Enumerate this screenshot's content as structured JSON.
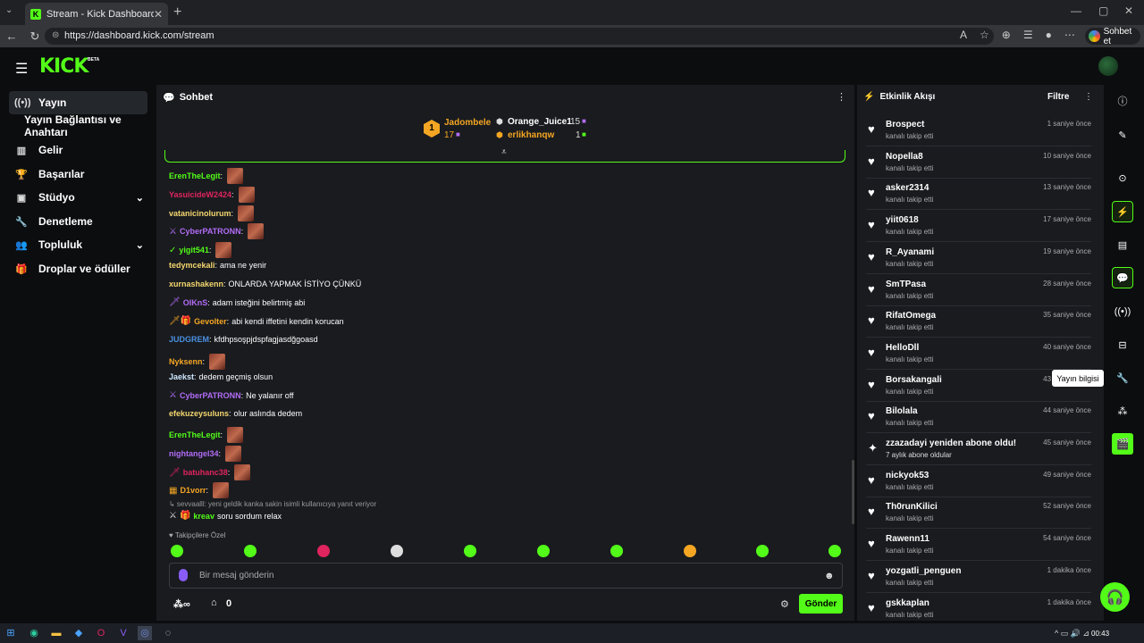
{
  "browser": {
    "tab_title": "Stream - Kick Dashboard",
    "tab_close": "✕",
    "new_tab": "+",
    "url": "https://dashboard.kick.com/stream",
    "sohbet_label": "Sohbet et"
  },
  "app": {
    "logo": "KICK",
    "beta": "BETA"
  },
  "sidebar": {
    "items": [
      {
        "label": "Yayın"
      },
      {
        "label": "Yayın Bağlantısı ve Anahtarı"
      },
      {
        "label": "Gelir"
      },
      {
        "label": "Başarılar"
      },
      {
        "label": "Stüdyo"
      },
      {
        "label": "Denetleme"
      },
      {
        "label": "Topluluk"
      },
      {
        "label": "Droplar ve ödüller"
      }
    ]
  },
  "chat": {
    "title": "Sohbet",
    "top_gifters": [
      {
        "rank": "1",
        "name": "Jadombele",
        "count": "17"
      },
      {
        "name": "Orange_Juice1",
        "count": "15"
      },
      {
        "name": "erlikhanqw",
        "count": "1"
      }
    ],
    "messages": [
      {
        "user": "ErenTheLegit",
        "color": "#53fc18",
        "text": "",
        "emote": true
      },
      {
        "user": "YasuicideW2424",
        "color": "#e0245e",
        "text": "",
        "emote": true
      },
      {
        "user": "vatanicinolurum",
        "color": "#f5d76e",
        "text": "",
        "emote": true
      },
      {
        "user": "CyberPATRONN",
        "color": "#b26cf5",
        "text": "",
        "emote": true,
        "badge": "⚔"
      },
      {
        "user": "yigit541",
        "color": "#53fc18",
        "text": "",
        "emote": true,
        "badge": "✓"
      },
      {
        "user": "tedymcekali",
        "color": "#f5d76e",
        "text": "ama ne yenir"
      },
      {
        "user": "xurnashakenn",
        "color": "#f5d76e",
        "text": "ONLARDA YAPMAK İSTİYO ÇÜNKÜ"
      },
      {
        "user": "OIKnS",
        "color": "#b26cf5",
        "text": "adam isteğini belirtmiş abi",
        "badge": "🗡"
      },
      {
        "user": "Gevolter",
        "color": "#f5a623",
        "text": "abi kendi iffetini kendin korucan",
        "badge": "🗡🎁"
      },
      {
        "user": "JUDGREM",
        "color": "#4a90e2",
        "text": "kfdhpsoşpjdspfagjasdğgoasd"
      },
      {
        "user": "Nyksenn",
        "color": "#f5a623",
        "text": "",
        "emote": true
      },
      {
        "user": "Jaekst",
        "color": "#cfe8ff",
        "text": "dedem geçmiş olsun"
      },
      {
        "user": "CyberPATRONN",
        "color": "#b26cf5",
        "text": "Ne yalanır off",
        "badge": "⚔"
      },
      {
        "user": "efekuzeysuluns",
        "color": "#f5d76e",
        "text": "olur aslında dedem"
      },
      {
        "user": "ErenTheLegit",
        "color": "#53fc18",
        "text": "",
        "emote": true
      },
      {
        "user": "nightangel34",
        "color": "#b26cf5",
        "text": "",
        "emote": true
      },
      {
        "user": "batuhanc38",
        "color": "#e0245e",
        "text": "",
        "emote": true,
        "badge": "🗡"
      },
      {
        "user": "D1vorr",
        "color": "#f5a623",
        "text": "",
        "emote": true,
        "badge": "▦"
      }
    ],
    "reply": "↳ sevvaalll: yeni geldik kanka sakin isimli kullanıcıya yanıt veriyor",
    "last_message": {
      "user": "kreav",
      "color": "#53fc18",
      "text": "soru sordum relax"
    },
    "followers_only": "♥ Takipçilere Özel",
    "placeholder": "Bir mesaj gönderin",
    "gift_count": "0",
    "send": "Gönder"
  },
  "activity": {
    "title": "Etkinlik Akışı",
    "filter": "Filtre",
    "events": [
      {
        "name": "Brospect",
        "sub": "kanalı takip etti",
        "time": "1 saniye önce"
      },
      {
        "name": "Nopella8",
        "sub": "kanalı takip etti",
        "time": "10 saniye önce"
      },
      {
        "name": "asker2314",
        "sub": "kanalı takip etti",
        "time": "13 saniye önce"
      },
      {
        "name": "yiit0618",
        "sub": "kanalı takip etti",
        "time": "17 saniye önce"
      },
      {
        "name": "R_Ayanami",
        "sub": "kanalı takip etti",
        "time": "19 saniye önce"
      },
      {
        "name": "SmTPasa",
        "sub": "kanalı takip etti",
        "time": "28 saniye önce"
      },
      {
        "name": "RifatOmega",
        "sub": "kanalı takip etti",
        "time": "35 saniye önce"
      },
      {
        "name": "HelloDll",
        "sub": "kanalı takip etti",
        "time": "40 saniye önce"
      },
      {
        "name": "Borsakangali",
        "sub": "kanalı takip etti",
        "time": "43 saniye önce"
      },
      {
        "name": "Bilolala",
        "sub": "kanalı takip etti",
        "time": "44 saniye önce"
      },
      {
        "name": "zzazadayi yeniden abone oldu!",
        "sub": "7 aylık abone oldular",
        "time": "45 saniye önce",
        "sub_event": true
      },
      {
        "name": "nickyok53",
        "sub": "kanalı takip etti",
        "time": "49 saniye önce"
      },
      {
        "name": "Th0runKilici",
        "sub": "kanalı takip etti",
        "time": "52 saniye önce"
      },
      {
        "name": "Rawenn11",
        "sub": "kanalı takip etti",
        "time": "54 saniye önce"
      },
      {
        "name": "yozgatli_penguen",
        "sub": "kanalı takip etti",
        "time": "1 dakika önce"
      },
      {
        "name": "gskkaplan",
        "sub": "kanalı takip etti",
        "time": "1 dakika önce"
      }
    ]
  },
  "rail": {
    "tooltip": "Yayın bilgisi"
  },
  "taskbar": {
    "time": "00:43"
  },
  "colors": {
    "accent": "#53fc18",
    "panel": "#191b1f",
    "background": "#0b0d0f"
  }
}
